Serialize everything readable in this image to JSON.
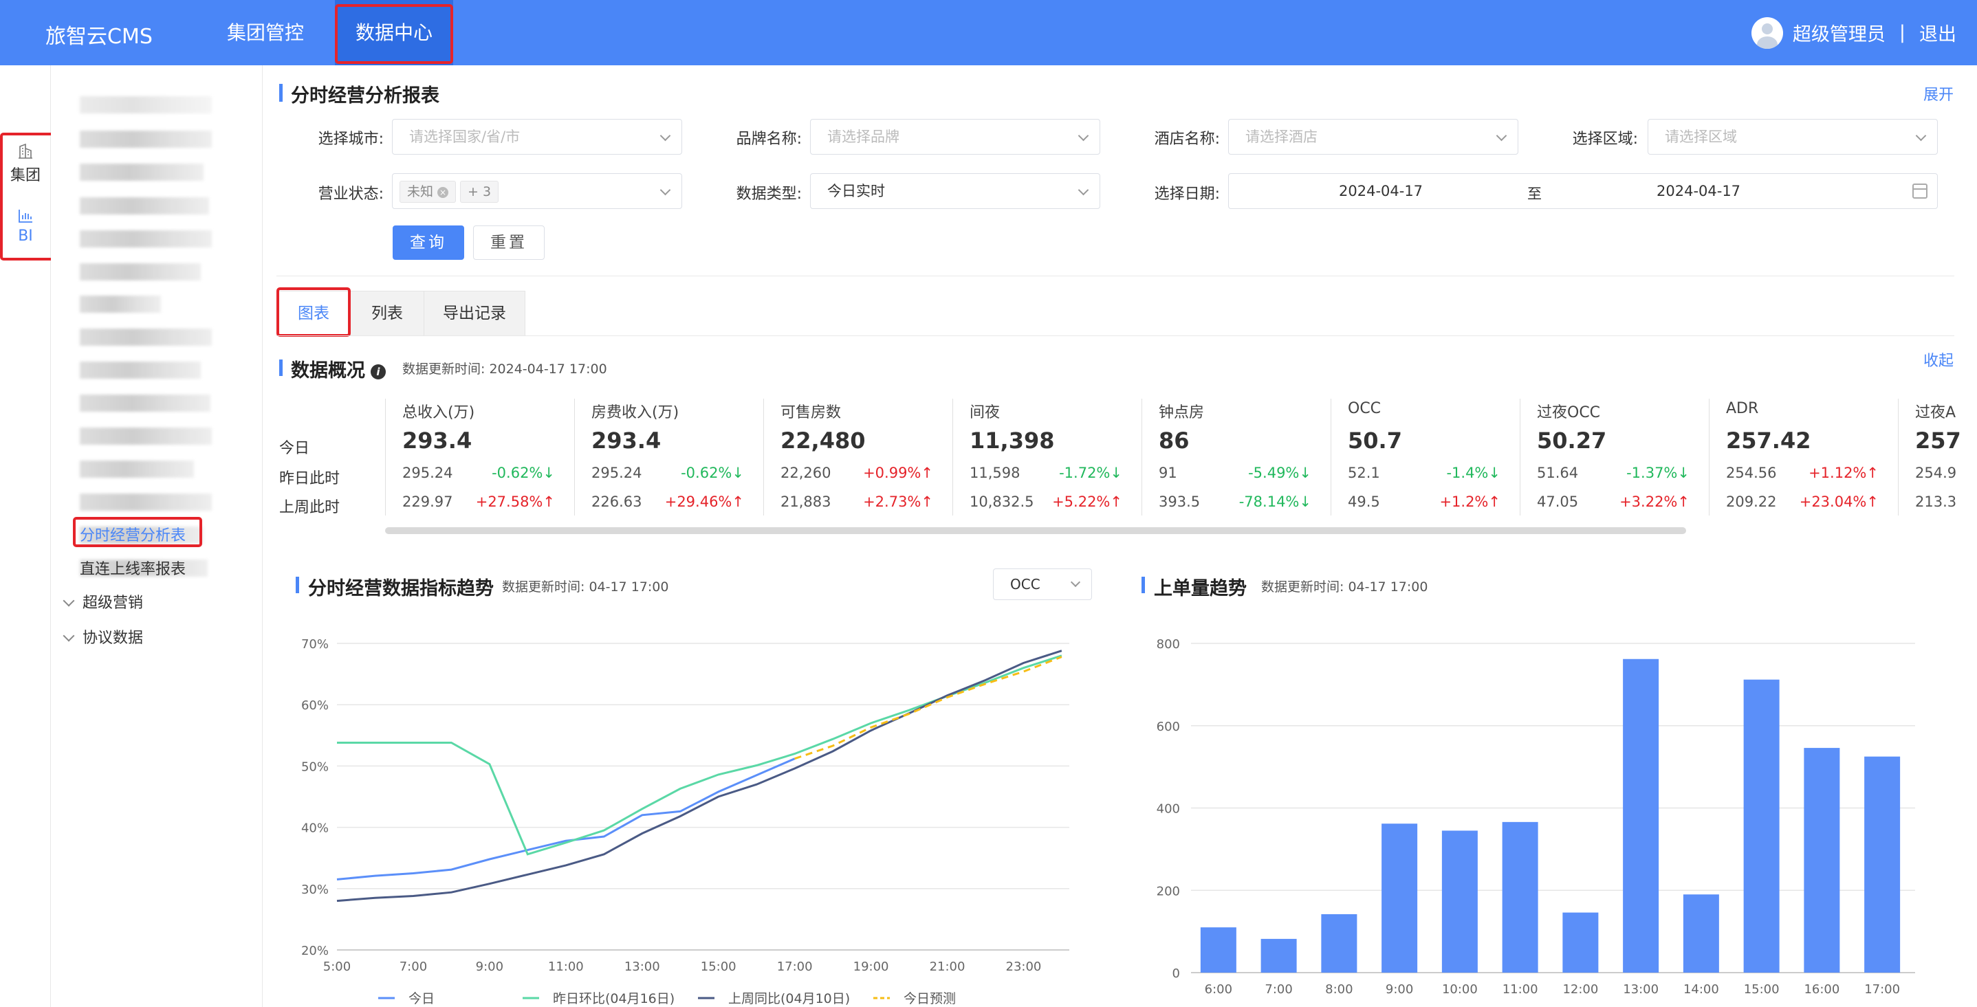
{
  "header": {
    "logo": "旅智云CMS",
    "nav": [
      "集团管控",
      "数据中心"
    ],
    "active_nav": "数据中心",
    "user": "超级管理员",
    "separator": "|",
    "logout": "退出"
  },
  "rail": {
    "items": [
      "集团",
      "BI"
    ],
    "active": "BI"
  },
  "submenu": {
    "active_item": "分时经营分析表",
    "item2": "直连上线率报表",
    "groups": [
      "超级营销",
      "协议数据"
    ]
  },
  "filters": {
    "title": "分时经营分析报表",
    "expand": "展开",
    "city": {
      "label": "选择城市:",
      "placeholder": "请选择国家/省/市"
    },
    "brand": {
      "label": "品牌名称:",
      "placeholder": "请选择品牌"
    },
    "hotel": {
      "label": "酒店名称:",
      "placeholder": "请选择酒店"
    },
    "region": {
      "label": "选择区域:",
      "placeholder": "请选择区域"
    },
    "status": {
      "label": "营业状态:",
      "tag": "未知",
      "more": "+ 3"
    },
    "data_type": {
      "label": "数据类型:",
      "value": "今日实时"
    },
    "date": {
      "label": "选择日期:",
      "start": "2024-04-17",
      "sep": "至",
      "end": "2024-04-17"
    },
    "query": "查询",
    "reset": "重置"
  },
  "tabs": [
    "图表",
    "列表",
    "导出记录"
  ],
  "active_tab": "图表",
  "overview": {
    "title": "数据概况",
    "info": "i",
    "update": "数据更新时间: 2024-04-17 17:00",
    "collapse": "收起",
    "row_labels": [
      "今日",
      "昨日此时",
      "上周此时"
    ],
    "metrics": [
      {
        "name": "总收入(万)",
        "today": "293.4",
        "yday": "295.24",
        "yday_chg": "-0.62%",
        "yday_dir": "down",
        "week": "229.97",
        "week_chg": "+27.58%",
        "week_dir": "up"
      },
      {
        "name": "房费收入(万)",
        "today": "293.4",
        "yday": "295.24",
        "yday_chg": "-0.62%",
        "yday_dir": "down",
        "week": "226.63",
        "week_chg": "+29.46%",
        "week_dir": "up"
      },
      {
        "name": "可售房数",
        "today": "22,480",
        "yday": "22,260",
        "yday_chg": "+0.99%",
        "yday_dir": "up",
        "week": "21,883",
        "week_chg": "+2.73%",
        "week_dir": "up"
      },
      {
        "name": "间夜",
        "today": "11,398",
        "yday": "11,598",
        "yday_chg": "-1.72%",
        "yday_dir": "down",
        "week": "10,832.5",
        "week_chg": "+5.22%",
        "week_dir": "up"
      },
      {
        "name": "钟点房",
        "today": "86",
        "yday": "91",
        "yday_chg": "-5.49%",
        "yday_dir": "down",
        "week": "393.5",
        "week_chg": "-78.14%",
        "week_dir": "down"
      },
      {
        "name": "OCC",
        "today": "50.7",
        "yday": "52.1",
        "yday_chg": "-1.4%",
        "yday_dir": "down",
        "week": "49.5",
        "week_chg": "+1.2%",
        "week_dir": "up"
      },
      {
        "name": "过夜OCC",
        "today": "50.27",
        "yday": "51.64",
        "yday_chg": "-1.37%",
        "yday_dir": "down",
        "week": "47.05",
        "week_chg": "+3.22%",
        "week_dir": "up"
      },
      {
        "name": "ADR",
        "today": "257.42",
        "yday": "254.56",
        "yday_chg": "+1.12%",
        "yday_dir": "up",
        "week": "209.22",
        "week_chg": "+23.04%",
        "week_dir": "up"
      },
      {
        "name": "过夜A",
        "today": "257",
        "yday": "254.9",
        "yday_chg": "",
        "yday_dir": "up",
        "week": "213.3",
        "week_chg": "",
        "week_dir": "up"
      }
    ]
  },
  "trend": {
    "title": "分时经营数据指标趋势",
    "update": "数据更新时间: 04-17 17:00",
    "metric_select": "OCC"
  },
  "orders": {
    "title": "上单量趋势",
    "update": "数据更新时间: 04-17 17:00"
  },
  "colors": {
    "accent": "#4a86f7",
    "up": "#e5232a",
    "down": "#21b85c",
    "highlight": "#e5232a"
  },
  "chart_data": [
    {
      "type": "line",
      "x": [
        "5:00",
        "6:00",
        "7:00",
        "8:00",
        "9:00",
        "10:00",
        "11:00",
        "12:00",
        "13:00",
        "14:00",
        "15:00",
        "16:00",
        "17:00",
        "18:00",
        "19:00",
        "20:00",
        "21:00",
        "22:00",
        "23:00",
        "24:00"
      ],
      "xticks": [
        "5:00",
        "7:00",
        "9:00",
        "11:00",
        "13:00",
        "15:00",
        "17:00",
        "19:00",
        "21:00",
        "23:00"
      ],
      "yticks": [
        "20%",
        "30%",
        "40%",
        "50%",
        "60%",
        "70%"
      ],
      "ylim": [
        20,
        70
      ],
      "series": [
        {
          "name": "今日",
          "color": "#5b8ff9",
          "values": [
            31.5,
            32.1,
            32.5,
            33.1,
            34.8,
            36.3,
            37.8,
            38.5,
            42,
            42.6,
            45.8,
            48.5,
            51.2,
            null,
            null,
            null,
            null,
            null,
            null,
            null
          ]
        },
        {
          "name": "昨日环比(04月16日)",
          "color": "#5ad8a6",
          "values": [
            53.8,
            53.8,
            53.8,
            53.8,
            50.3,
            35.6,
            37.5,
            39.5,
            43,
            46.3,
            48.6,
            50.1,
            52,
            54.4,
            57,
            59.1,
            61.4,
            63.6,
            66,
            68
          ]
        },
        {
          "name": "上周同比(04月10日)",
          "color": "#4a5a85",
          "values": [
            28,
            28.5,
            28.8,
            29.4,
            30.8,
            32.3,
            33.8,
            35.6,
            39,
            41.8,
            45,
            47,
            49.6,
            52.4,
            55.8,
            58.6,
            61.5,
            64,
            66.8,
            68.8
          ]
        },
        {
          "name": "今日预测",
          "color": "#f6bd16",
          "dashed": true,
          "values": [
            null,
            null,
            null,
            null,
            null,
            null,
            null,
            null,
            null,
            null,
            null,
            null,
            51.2,
            53.3,
            56.3,
            58.5,
            61.2,
            63.4,
            65.4,
            67.8
          ]
        }
      ]
    },
    {
      "type": "bar",
      "categories": [
        "6:00",
        "7:00",
        "8:00",
        "9:00",
        "10:00",
        "11:00",
        "12:00",
        "13:00",
        "14:00",
        "15:00",
        "16:00",
        "17:00"
      ],
      "values": [
        110,
        82,
        142,
        362,
        345,
        366,
        146,
        762,
        190,
        712,
        546,
        525
      ],
      "yticks": [
        "0",
        "200",
        "400",
        "600",
        "800"
      ],
      "ylim": [
        0,
        800
      ]
    }
  ]
}
